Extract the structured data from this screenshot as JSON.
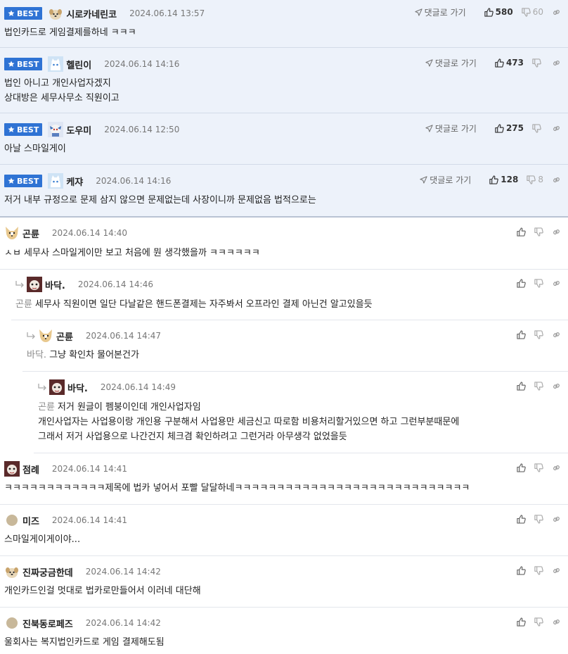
{
  "labels": {
    "best": "BEST",
    "reply_go": "댓글로 가기"
  },
  "best_comments": [
    {
      "nick": "시로카네린코",
      "date": "2024.06.14 13:57",
      "up": "580",
      "down": "60",
      "lines": [
        "법인카드로 게임결제를하네 ㅋㅋㅋ"
      ],
      "avatar": "dog-avatar"
    },
    {
      "nick": "헬린이",
      "date": "2024.06.14 14:16",
      "up": "473",
      "down": "",
      "lines": [
        "법인 아니고 개인사업자겠지",
        "상대방은 세무사무소 직원이고"
      ],
      "avatar": "white-cat-avatar"
    },
    {
      "nick": "도우미",
      "date": "2024.06.14 12:50",
      "up": "275",
      "down": "",
      "lines": [
        "아날 스마일게이"
      ],
      "avatar": "character-avatar"
    },
    {
      "nick": "케쟈",
      "date": "2024.06.14 14:16",
      "up": "128",
      "down": "8",
      "lines": [
        "저거 내부 규정으로 문제 삼지 않으면 문제없는데 사장이니까 문제없음 법적으로는"
      ],
      "avatar": "white-cat-avatar"
    }
  ],
  "comments": [
    {
      "nick": "곤륜",
      "date": "2024.06.14 14:40",
      "mention": "",
      "lines": [
        "ㅅㅂ 세무사 스마일게이만 보고 처음에 뭔 생각했을까 ㅋㅋㅋㅋㅋㅋ"
      ],
      "avatar": "fox-avatar"
    },
    {
      "nick": "바닥.",
      "date": "2024.06.14 14:46",
      "mention": "곤륜",
      "lines": [
        "세무사 직원이면 일단 다날같은 핸드폰결제는 자주봐서 오프라인 결제 아닌건 알고있을듯"
      ],
      "avatar": "dark-avatar"
    },
    {
      "nick": "곤륜",
      "date": "2024.06.14 14:47",
      "mention": "바닥.",
      "lines": [
        "그냥 확인차 물어본건가"
      ],
      "avatar": "fox-avatar"
    },
    {
      "nick": "바닥.",
      "date": "2024.06.14 14:49",
      "mention": "곤륜",
      "lines": [
        "저거 원글이 펨붕이인데 개인사업자임",
        "개인사업자는 사업용이랑 개인용 구분해서 사업용만 세금신고 따로함 비용처리할거있으면 하고 그런부분때문에",
        "그래서 저거 사업용으로 나간건지 체크겸 확인하려고 그런거라 아무생각 없었을듯"
      ],
      "avatar": "dark-avatar"
    },
    {
      "nick": "점례",
      "date": "2024.06.14 14:41",
      "mention": "",
      "lines": [
        "ㅋㅋㅋㅋㅋㅋㅋㅋㅋㅋㅋㅋ제목에 법카 넣어서 포빨 달달하네ㅋㅋㅋㅋㅋㅋㅋㅋㅋㅋㅋㅋㅋㅋㅋㅋㅋㅋㅋㅋㅋㅋㅋㅋㅋㅋㅋㅋ"
      ],
      "avatar": "dark-avatar"
    },
    {
      "nick": "미즈",
      "date": "2024.06.14 14:41",
      "mention": "",
      "lines": [
        "스마일게이게이야..."
      ],
      "avatar": "circle-avatar"
    },
    {
      "nick": "진짜궁금한데",
      "date": "2024.06.14 14:42",
      "mention": "",
      "lines": [
        "개인카드인걸 멋대로 법카로만들어서 이러네 대단해"
      ],
      "avatar": "dog-avatar"
    },
    {
      "nick": "진북동로페즈",
      "date": "2024.06.14 14:42",
      "mention": "",
      "lines": [
        "울회사는 복지법인카드로 게임 결제해도됨"
      ],
      "avatar": "circle-avatar"
    }
  ]
}
